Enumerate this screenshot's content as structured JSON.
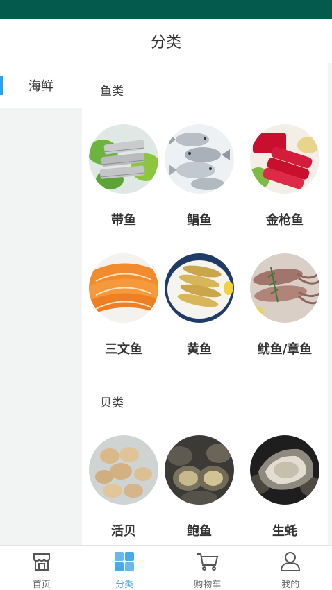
{
  "header": {
    "title": "分类"
  },
  "sidebar": {
    "items": [
      {
        "label": "海鲜",
        "active": true
      }
    ]
  },
  "sections": [
    {
      "title": "鱼类",
      "items": [
        {
          "label": "带鱼",
          "image": "hairtail-photo"
        },
        {
          "label": "鲳鱼",
          "image": "pomfret-photo"
        },
        {
          "label": "金枪鱼",
          "image": "tuna-photo"
        },
        {
          "label": "三文鱼",
          "image": "salmon-photo"
        },
        {
          "label": "黄鱼",
          "image": "yellow-croaker-photo"
        },
        {
          "label": "鱿鱼/章鱼",
          "image": "squid-photo"
        }
      ]
    },
    {
      "title": "贝类",
      "items": [
        {
          "label": "活贝",
          "image": "clams-photo"
        },
        {
          "label": "鲍鱼",
          "image": "abalone-photo"
        },
        {
          "label": "生蚝",
          "image": "oyster-photo"
        }
      ]
    }
  ],
  "tabbar": {
    "tabs": [
      {
        "label": "首页",
        "icon": "store-icon"
      },
      {
        "label": "分类",
        "icon": "grid-icon",
        "active": true
      },
      {
        "label": "购物车",
        "icon": "cart-icon"
      },
      {
        "label": "我的",
        "icon": "user-icon"
      }
    ]
  },
  "colors": {
    "status_bar": "#045a4c",
    "accent": "#4aa9e8",
    "sidebar_marker": "#29a3f0",
    "sidebar_bg": "#f2f4f3"
  }
}
